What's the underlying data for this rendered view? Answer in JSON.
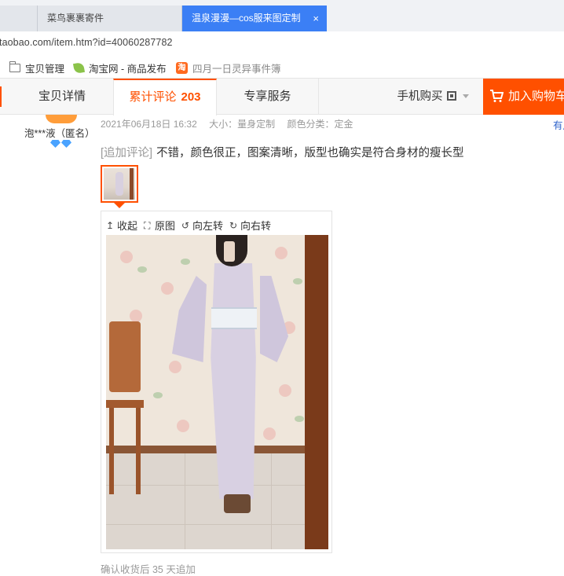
{
  "browser": {
    "tabs": [
      {
        "label": ""
      },
      {
        "label": "菜鸟裹裹寄件"
      },
      {
        "label": "温泉漫漫—cos服来图定制",
        "close": "×"
      }
    ],
    "address": "taobao.com/item.htm?id=40060287782",
    "bookmarks": [
      {
        "label": "宝贝管理",
        "icon": "folder-icon"
      },
      {
        "label": "淘宝网 - 商品发布",
        "icon": "leaf-icon"
      },
      {
        "label": "四月一日灵异事件簿",
        "icon": "taobao-icon",
        "icon_text": "淘"
      }
    ]
  },
  "nav": {
    "tabs": [
      {
        "label": "宝贝详情"
      },
      {
        "label": "累计评论",
        "count": "203"
      },
      {
        "label": "专享服务"
      }
    ],
    "mobile_buy": "手机购买",
    "add_cart": "加入购物车"
  },
  "review": {
    "username": "泡***液（匿名）",
    "date": "2021年06月18日 16:32",
    "size": "大小：量身定制",
    "color": "颜色分类：定金",
    "report": "有用",
    "followup_tag": "[追加评论]",
    "followup_text": "不错，颜色很正，图案清晰，版型也确实是符合身材的瘦长型",
    "viewer_tools": [
      {
        "label": "收起",
        "icon": "collapse-icon"
      },
      {
        "label": "原图",
        "icon": "fullscreen-icon"
      },
      {
        "label": "向左转",
        "icon": "rotate-left-icon"
      },
      {
        "label": "向右转",
        "icon": "rotate-right-icon"
      }
    ],
    "footer": "确认收货后 35 天追加"
  },
  "colors": {
    "accent": "#ff5000",
    "active_tab": "#3b7ff5",
    "link": "#3366cc"
  }
}
